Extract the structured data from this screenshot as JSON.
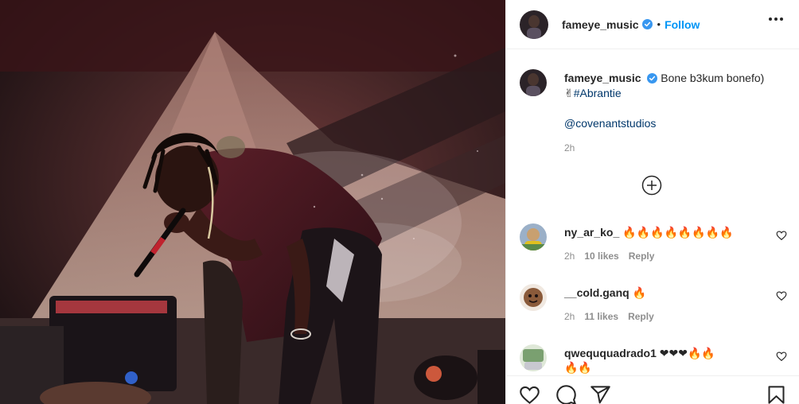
{
  "post": {
    "username": "fameye_music",
    "follow_label": "Follow",
    "separator": "•",
    "verified": true
  },
  "caption": {
    "username": "fameye_music",
    "text_line1": "Bone b3kum bonefo)",
    "emoji": "✌",
    "hashtag": "#Abrantie",
    "mention": "@covenantstudios",
    "time": "2h"
  },
  "comments": [
    {
      "username": "ny_ar_ko_",
      "text": "🔥🔥🔥🔥🔥🔥🔥🔥",
      "time": "2h",
      "likes": "10 likes",
      "reply": "Reply"
    },
    {
      "username": "__cold.ganq",
      "text": "🔥",
      "time": "2h",
      "likes": "11 likes",
      "reply": "Reply"
    },
    {
      "username": "qweququadrado1",
      "text": "❤❤❤🔥🔥",
      "text_wrap": "🔥🔥"
    }
  ],
  "icons": {
    "more": "more-options-icon",
    "load_more": "plus-circle-icon",
    "like": "heart-icon",
    "comment": "comment-bubble-icon",
    "share": "paper-plane-icon",
    "save": "bookmark-icon",
    "verified": "verified-badge-icon"
  },
  "colors": {
    "accent": "#0095f6",
    "link": "#00376b",
    "muted": "#8e8e8e",
    "text": "#262626",
    "border": "#efefef",
    "heart_red": "#ed4956"
  }
}
